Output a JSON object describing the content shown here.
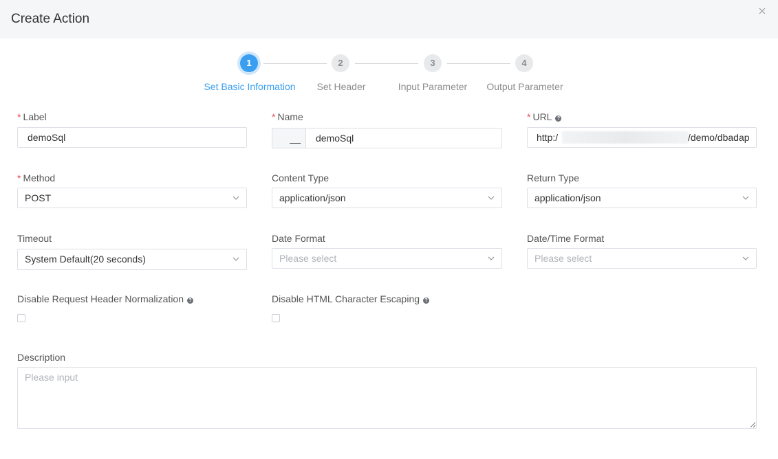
{
  "dialog": {
    "title": "Create Action",
    "close_glyph": "×"
  },
  "steps": [
    {
      "number": "1",
      "label": "Set Basic Information",
      "active": true
    },
    {
      "number": "2",
      "label": "Set Header",
      "active": false
    },
    {
      "number": "3",
      "label": "Input Parameter",
      "active": false
    },
    {
      "number": "4",
      "label": "Output Parameter",
      "active": false
    }
  ],
  "form": {
    "label": {
      "required": "*",
      "label": "Label",
      "value": "demoSql"
    },
    "name": {
      "required": "*",
      "label": "Name",
      "prefix": "__",
      "value": "demoSql"
    },
    "url": {
      "required": "*",
      "label": "URL",
      "help": "?",
      "value_start": "http:/",
      "value_end": "/demo/dbadap"
    },
    "method": {
      "required": "*",
      "label": "Method",
      "value": "POST"
    },
    "content_type": {
      "label": "Content Type",
      "value": "application/json"
    },
    "return_type": {
      "label": "Return Type",
      "value": "application/json"
    },
    "timeout": {
      "label": "Timeout",
      "value": "System Default(20 seconds)"
    },
    "date_format": {
      "label": "Date Format",
      "placeholder": "Please select"
    },
    "datetime_format": {
      "label": "Date/Time Format",
      "placeholder": "Please select"
    },
    "disable_header_normalization": {
      "label": "Disable Request Header Normalization",
      "help": "?",
      "checked": false
    },
    "disable_html_escaping": {
      "label": "Disable HTML Character Escaping",
      "help": "?",
      "checked": false
    },
    "description": {
      "label": "Description",
      "placeholder": "Please input"
    }
  },
  "colors": {
    "accent": "#3a9ff0",
    "required": "#e34d59",
    "header_bg": "#f5f6f7"
  }
}
